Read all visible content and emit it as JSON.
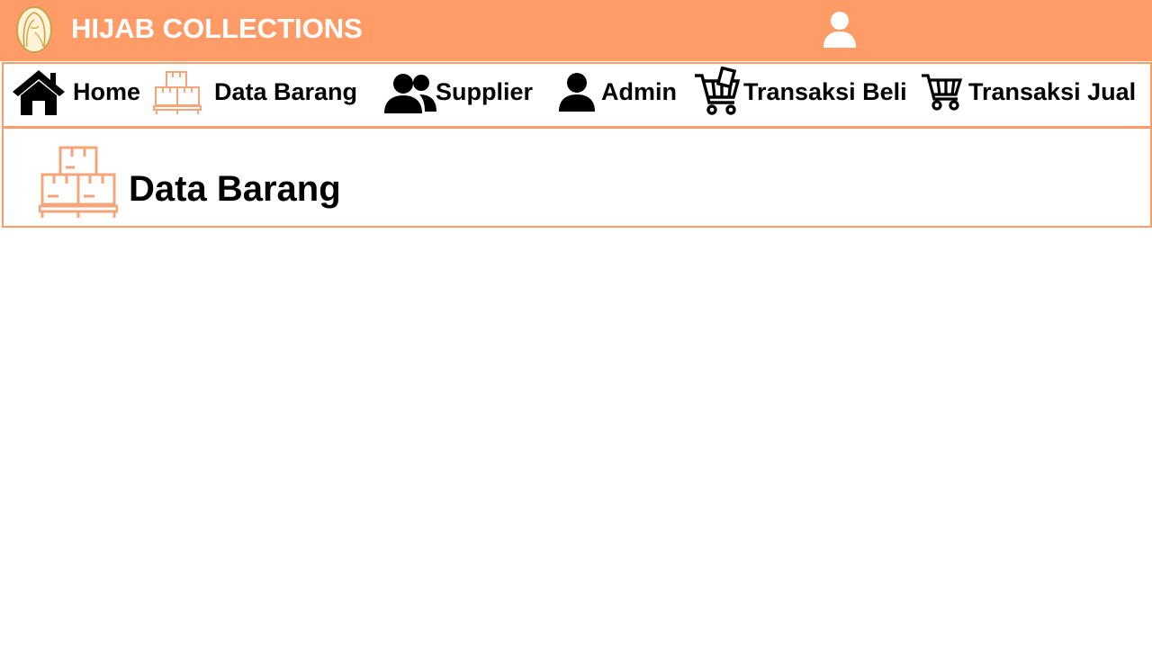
{
  "header": {
    "brand": "HIJAB COLLECTIONS",
    "logo_icon": "hijab-woman-logo",
    "user_icon": "user-icon",
    "background_color": "#ff9b66"
  },
  "nav": {
    "items": [
      {
        "label": "Home",
        "icon": "home-icon"
      },
      {
        "label": "Data Barang",
        "icon": "boxes-icon"
      },
      {
        "label": "Supplier",
        "icon": "users-icon"
      },
      {
        "label": "Admin",
        "icon": "user-icon"
      },
      {
        "label": "Transaksi Beli",
        "icon": "cart-with-phone-icon"
      },
      {
        "label": "Transaksi Jual",
        "icon": "cart-icon"
      }
    ],
    "active": "Data Barang"
  },
  "page": {
    "title": "Data Barang",
    "title_icon": "boxes-icon",
    "accent_color": "#ff9b66"
  }
}
